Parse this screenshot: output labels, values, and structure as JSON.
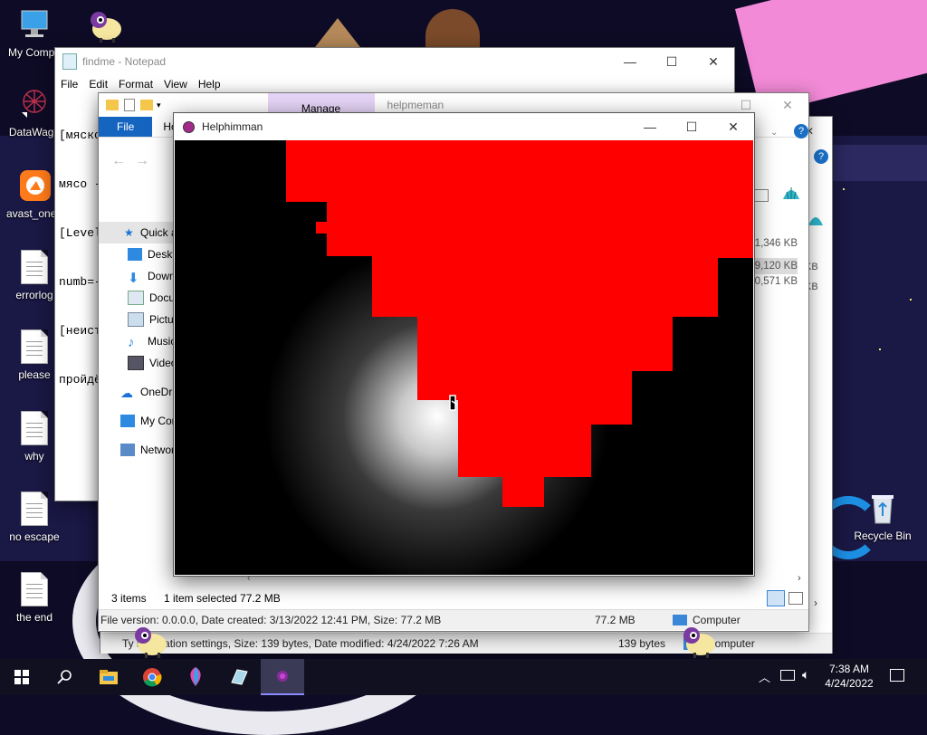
{
  "desktop": {
    "icons": [
      {
        "label": "My Compu",
        "icon": "computer-icon"
      },
      {
        "label": "DataWago",
        "icon": "datawagon-icon"
      },
      {
        "label": "avast_one_",
        "icon": "avast-icon"
      },
      {
        "label": "errorlog",
        "icon": "text-file-icon"
      },
      {
        "label": "please",
        "icon": "text-file-icon"
      },
      {
        "label": "why",
        "icon": "text-file-icon"
      },
      {
        "label": "no escape",
        "icon": "text-file-icon"
      },
      {
        "label": "the end",
        "icon": "text-file-icon"
      },
      {
        "label": "Recycle Bin",
        "icon": "recycle-bin-icon"
      }
    ]
  },
  "notepad": {
    "title": "findme - Notepad",
    "menu": [
      "File",
      "Edit",
      "Format",
      "View",
      "Help"
    ],
    "text_lines": [
      "[мяско",
      "мясо -",
      "[Level",
      "numb=-",
      "[неист",
      "пройдё"
    ]
  },
  "explorer": {
    "manage_tab": "Manage",
    "title": "helpmeman",
    "ribbon_file": "File",
    "ribbon_home": "Ho",
    "nav": [
      {
        "label": "Quick a",
        "icon": "star-icon"
      },
      {
        "label": "Deskt",
        "icon": "desktop-icon"
      },
      {
        "label": "Down",
        "icon": "download-icon"
      },
      {
        "label": "Docu",
        "icon": "documents-icon"
      },
      {
        "label": "Pictur",
        "icon": "pictures-icon"
      },
      {
        "label": "Music",
        "icon": "music-icon"
      },
      {
        "label": "Video",
        "icon": "video-icon"
      },
      {
        "label": "OneDriv",
        "icon": "onedrive-icon"
      },
      {
        "label": "My Cor",
        "icon": "computer-icon"
      },
      {
        "label": "Networ",
        "icon": "network-icon"
      }
    ],
    "sizes": [
      "1,346 KB",
      "9,120 KB",
      "0,571 KB"
    ],
    "sizes_back": [
      "KB",
      "KB"
    ],
    "items_count": "3 items",
    "selected": "1 item selected  77.2 MB",
    "status_left": "File version: 0.0.0.0, Date created: 3/13/2022 12:41 PM, Size: 77.2 MB",
    "status_size": "77.2 MB",
    "status_location": "Computer"
  },
  "explorer_back": {
    "status_left": "Ty       nfiguration settings, Size: 139 bytes, Date modified: 4/24/2022 7:26 AM",
    "status_size": "139 bytes",
    "status_location": "Computer"
  },
  "helphimman": {
    "title": "Helphimman"
  },
  "taskbar": {
    "apps": [
      "start-icon",
      "search-icon",
      "file-explorer-icon",
      "chrome-icon",
      "paint3d-icon",
      "app-icon",
      "helphimman-app-icon"
    ],
    "time": "7:38 AM",
    "date": "4/24/2022"
  },
  "colors": {
    "game_red": "#ff0000",
    "taskbar": "#101020",
    "accent_blue": "#0063b1"
  }
}
